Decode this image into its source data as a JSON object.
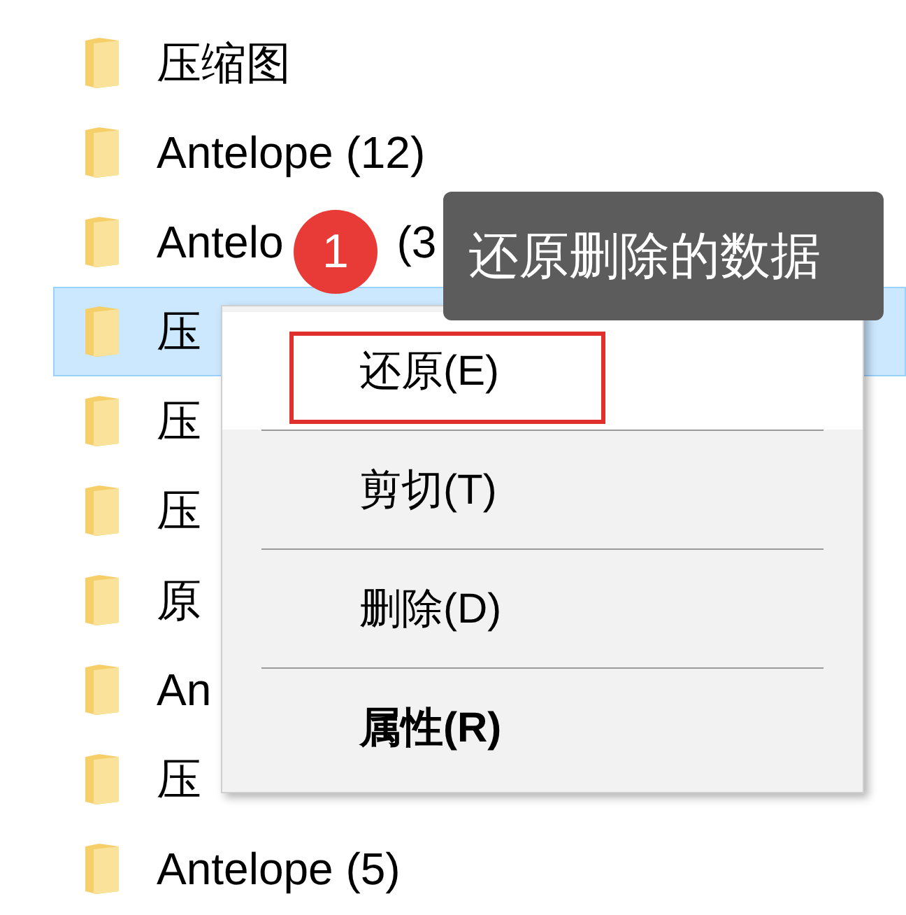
{
  "folders": [
    {
      "name": "压缩图",
      "selected": false
    },
    {
      "name": "Antelope (12)",
      "selected": false
    },
    {
      "name": "Antelo",
      "suffix": "(3",
      "selected": false
    },
    {
      "name": "压",
      "selected": true
    },
    {
      "name": "压",
      "selected": false
    },
    {
      "name": "压",
      "selected": false
    },
    {
      "name": "原",
      "selected": false
    },
    {
      "name": "An",
      "selected": false
    },
    {
      "name": "压",
      "selected": false
    },
    {
      "name": "Antelope (5)",
      "selected": false
    }
  ],
  "context_menu": {
    "items": [
      {
        "label": "还原(E)",
        "selected": true,
        "bold": false,
        "annotated": true
      },
      {
        "label": "剪切(T)",
        "selected": false,
        "bold": false,
        "annotated": false
      },
      {
        "label": "删除(D)",
        "selected": false,
        "bold": false,
        "annotated": false
      },
      {
        "label": "属性(R)",
        "selected": false,
        "bold": true,
        "annotated": false
      }
    ]
  },
  "step_badge": "1",
  "tooltip": "还原删除的数据"
}
